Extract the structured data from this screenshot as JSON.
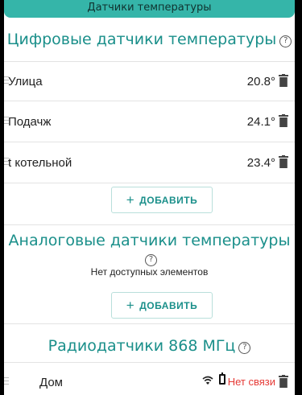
{
  "appbar": {
    "title": "Датчики температуры"
  },
  "digital": {
    "title": "Цифровые датчики температуры",
    "help": "?",
    "items": [
      {
        "name": "Улица",
        "temp": "20.8°"
      },
      {
        "name": "Подачж",
        "temp": "24.1°"
      },
      {
        "name": "t котельной",
        "temp": "23.4°"
      }
    ],
    "add_label": "ДОБАВИТЬ",
    "add_plus": "+"
  },
  "analog": {
    "title": "Аналоговые датчики температуры",
    "help": "?",
    "empty_message": "Нет доступных элементов",
    "add_label": "ДОБАВИТЬ",
    "add_plus": "+"
  },
  "radio": {
    "title": "Радиодатчики 868 МГц",
    "help": "?",
    "items": [
      {
        "name": "Дом",
        "status": "Нет связи"
      }
    ]
  },
  "colors": {
    "accent": "#1a8f8a",
    "appbar": "#35b5a9",
    "error": "#e53935"
  },
  "icons": {
    "help": "help-circle-icon",
    "delete": "trash-icon",
    "drag": "drag-handle-icon",
    "signal": "wifi-icon",
    "battery": "battery-icon"
  }
}
